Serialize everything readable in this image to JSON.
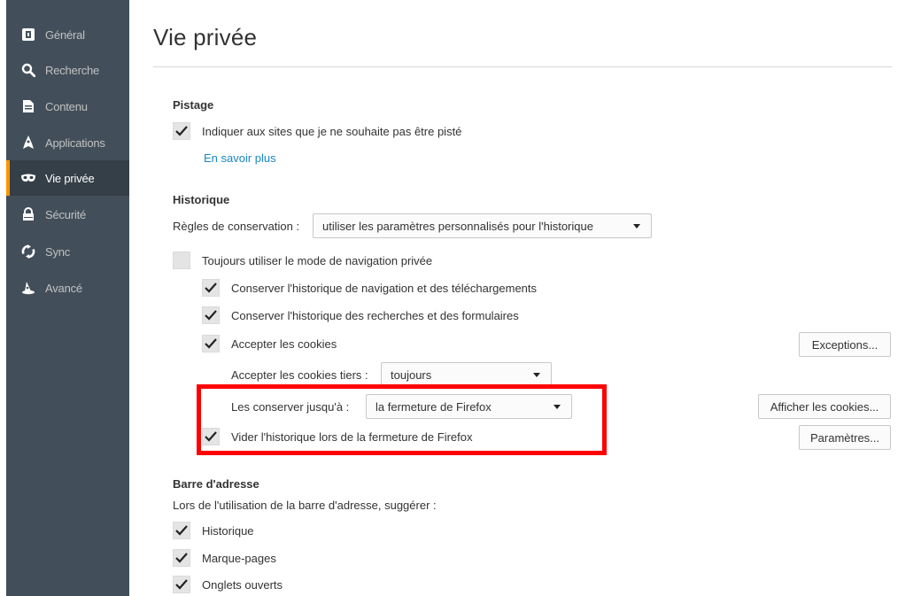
{
  "sidebar": {
    "items": [
      {
        "label": "Général",
        "icon": "general-icon"
      },
      {
        "label": "Recherche",
        "icon": "search-icon"
      },
      {
        "label": "Contenu",
        "icon": "document-icon"
      },
      {
        "label": "Applications",
        "icon": "rocket-icon"
      },
      {
        "label": "Vie privée",
        "icon": "mask-icon",
        "selected": true
      },
      {
        "label": "Sécurité",
        "icon": "lock-icon"
      },
      {
        "label": "Sync",
        "icon": "sync-icon"
      },
      {
        "label": "Avancé",
        "icon": "wizard-hat-icon"
      }
    ]
  },
  "main": {
    "title": "Vie privée",
    "tracking": {
      "heading": "Pistage",
      "do_not_track": {
        "label": "Indiquer aux sites que je ne souhaite pas être pisté",
        "checked": true
      },
      "learn_more": "En savoir plus"
    },
    "history": {
      "heading": "Historique",
      "rules_label": "Règles de conservation :",
      "rules_value": "utiliser les paramètres personnalisés pour l'historique",
      "private_mode": {
        "label": "Toujours utiliser le mode de navigation privée",
        "checked": false
      },
      "keep_browsing": {
        "label": "Conserver l'historique de navigation et des téléchargements",
        "checked": true
      },
      "keep_search": {
        "label": "Conserver l'historique des recherches et des formulaires",
        "checked": true
      },
      "accept_cookies": {
        "label": "Accepter les cookies",
        "checked": true
      },
      "exceptions_button": "Exceptions...",
      "third_party_label": "Accepter les cookies tiers :",
      "third_party_value": "toujours",
      "keep_until_label": "Les conserver jusqu'à :",
      "keep_until_value": "la fermeture de Firefox",
      "show_cookies_button": "Afficher les cookies...",
      "clear_on_close": {
        "label": "Vider l'historique lors de la fermeture de Firefox",
        "checked": true
      },
      "settings_button": "Paramètres..."
    },
    "address_bar": {
      "heading": "Barre d'adresse",
      "description": "Lors de l'utilisation de la barre d'adresse, suggérer :",
      "history": {
        "label": "Historique",
        "checked": true
      },
      "bookmarks": {
        "label": "Marque-pages",
        "checked": true
      },
      "open_tabs": {
        "label": "Onglets ouverts",
        "checked": true
      }
    }
  },
  "colors": {
    "sidebar_bg": "#424f5a",
    "sidebar_selected_bg": "#343f48",
    "selected_accent": "#ff9500",
    "highlight_border": "#ff0000",
    "link": "#1a87c6"
  }
}
